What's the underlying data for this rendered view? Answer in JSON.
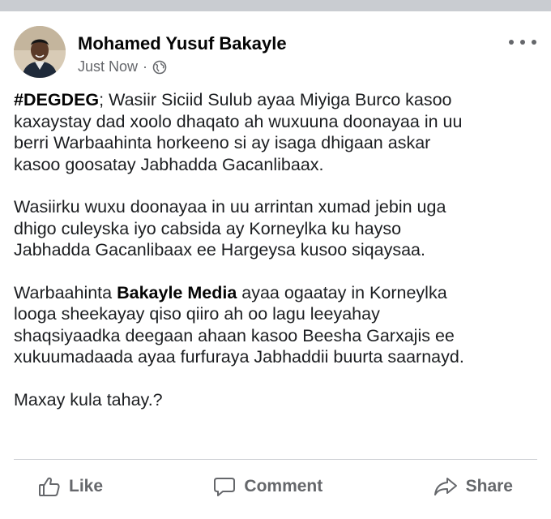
{
  "post": {
    "author": "Mohamed Yusuf Bakayle",
    "timestamp": "Just Now",
    "separator": "·",
    "privacy_icon": "globe-icon",
    "more_icon": "more-options-icon",
    "paragraphs": [
      {
        "lines": [
          {
            "hashtag": "#DEGDEG",
            "text": "; Wasiir Siciid Sulub ayaa Miyiga Burco kasoo"
          },
          {
            "text": "kaxaystay dad xoolo dhaqato ah wuxuuna doonayaa in uu"
          },
          {
            "text": "berri Warbaahinta horkeeno si ay isaga dhigaan askar"
          },
          {
            "text": "kasoo goosatay Jabhadda Gacanlibaax."
          }
        ]
      },
      {
        "lines": [
          {
            "text": "Wasiirku wuxu doonayaa in uu arrintan xumad jebin uga"
          },
          {
            "text": "dhigo culeyska iyo cabsida ay Korneylka ku hayso"
          },
          {
            "text": "Jabhadda Gacanlibaax ee Hargeysa kusoo siqaysaa."
          }
        ]
      },
      {
        "lines": [
          {
            "prefix": "Warbaahinta ",
            "bold": "Bakayle Media",
            "text": " ayaa ogaatay in Korneylka"
          },
          {
            "text": "looga sheekayay qiso qiiro ah oo lagu leeyahay"
          },
          {
            "text": "shaqsiyaadka deegaan ahaan kasoo Beesha Garxajis ee"
          },
          {
            "text": "xukuumadaada ayaa furfuraya Jabhaddii buurta saarnayd."
          }
        ]
      },
      {
        "lines": [
          {
            "text": "Maxay kula tahay.?"
          }
        ]
      }
    ]
  },
  "actions": {
    "like": {
      "label": "Like",
      "icon": "thumbs-up-icon"
    },
    "comment": {
      "label": "Comment",
      "icon": "comment-icon"
    },
    "share": {
      "label": "Share",
      "icon": "share-icon"
    }
  },
  "colors": {
    "text": "#1c1e21",
    "secondary": "#65676b",
    "divider": "#ced0d4",
    "top_bar": "#c9ccd1"
  }
}
